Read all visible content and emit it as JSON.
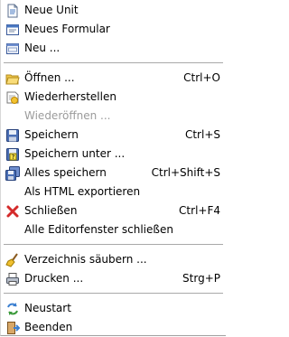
{
  "menu": {
    "items": [
      {
        "label": "Neue Unit",
        "shortcut": "",
        "icon": "new-unit-icon"
      },
      {
        "label": "Neues Formular",
        "shortcut": "",
        "icon": "new-form-icon"
      },
      {
        "label": "Neu ...",
        "shortcut": "",
        "icon": "new-icon"
      },
      {
        "label": "Öffnen ...",
        "shortcut": "Ctrl+O",
        "icon": "open-folder-icon"
      },
      {
        "label": "Wiederherstellen",
        "shortcut": "",
        "icon": "revert-icon"
      },
      {
        "label": "Wiederöffnen ...",
        "shortcut": "",
        "icon": "",
        "disabled": true
      },
      {
        "label": "Speichern",
        "shortcut": "Ctrl+S",
        "icon": "save-icon"
      },
      {
        "label": "Speichern unter ...",
        "shortcut": "",
        "icon": "save-as-icon"
      },
      {
        "label": "Alles speichern",
        "shortcut": "Ctrl+Shift+S",
        "icon": "save-all-icon"
      },
      {
        "label": "Als HTML exportieren",
        "shortcut": "",
        "icon": ""
      },
      {
        "label": "Schließen",
        "shortcut": "Ctrl+F4",
        "icon": "close-icon"
      },
      {
        "label": "Alle Editorfenster schließen",
        "shortcut": "",
        "icon": ""
      },
      {
        "label": "Verzeichnis säubern ...",
        "shortcut": "",
        "icon": "broom-icon"
      },
      {
        "label": "Drucken ...",
        "shortcut": "Strg+P",
        "icon": "print-icon"
      },
      {
        "label": "Neustart",
        "shortcut": "",
        "icon": "restart-icon"
      },
      {
        "label": "Beenden",
        "shortcut": "",
        "icon": "exit-icon"
      }
    ]
  },
  "colors": {
    "disabled": "#9b9b9b",
    "separator": "#a9a9a9",
    "close_icon": "#d42a2a"
  }
}
